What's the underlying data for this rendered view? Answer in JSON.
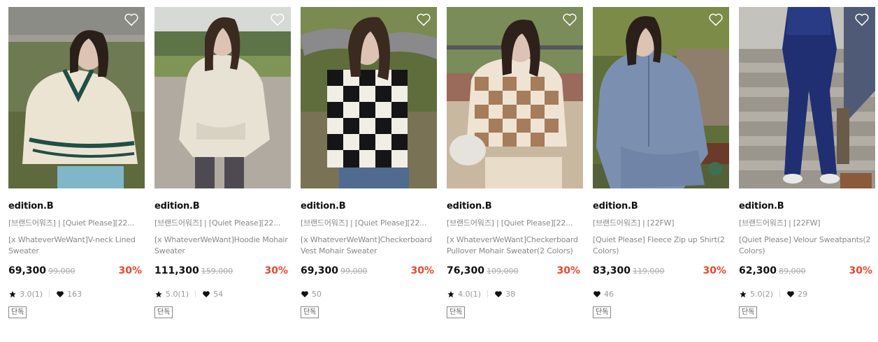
{
  "colors": {
    "discount": "#e8472b",
    "heart_outline": "#ffffff",
    "badge_border": "#888888"
  },
  "icons": {
    "wishlist": "heart-outline-icon",
    "rating": "star-icon",
    "likes": "heart-filled-icon"
  },
  "products": [
    {
      "brand": "edition.B",
      "name_line1": "[브랜드어워즈] | [Quiet Please][22...",
      "name_line2": "[x WhateverWeWant]V-neck Lined Sweater",
      "price": "69,300",
      "original_price": "99,000",
      "discount": "30%",
      "rating": "3.0(1)",
      "likes": "163",
      "badge": "단독"
    },
    {
      "brand": "edition.B",
      "name_line1": "[브랜드어워즈] | [Quiet Please][22...",
      "name_line2": "[x WhateverWeWant]Hoodie Mohair Sweater",
      "price": "111,300",
      "original_price": "159,000",
      "discount": "30%",
      "rating": "5.0(1)",
      "likes": "54",
      "badge": "단독"
    },
    {
      "brand": "edition.B",
      "name_line1": "[브랜드어워즈] | [Quiet Please][22...",
      "name_line2": "[x WhateverWeWant]Checkerboard Vest Mohair Sweater",
      "price": "69,300",
      "original_price": "99,000",
      "discount": "30%",
      "rating": null,
      "likes": "50",
      "badge": "단독"
    },
    {
      "brand": "edition.B",
      "name_line1": "[브랜드어워즈] | [Quiet Please][22...",
      "name_line2": "[x WhateverWeWant]Checkerboard Pullover Mohair Sweater(2 Colors)",
      "price": "76,300",
      "original_price": "109,000",
      "discount": "30%",
      "rating": "4.0(1)",
      "likes": "38",
      "badge": "단독"
    },
    {
      "brand": "edition.B",
      "name_line1": "[브랜드어워즈] | [22FW]",
      "name_line2": "[Quiet Please] Fleece Zip up Shirt(2 Colors)",
      "price": "83,300",
      "original_price": "119,000",
      "discount": "30%",
      "rating": null,
      "likes": "46",
      "badge": "단독"
    },
    {
      "brand": "edition.B",
      "name_line1": "[브랜드어워즈] | [22FW]",
      "name_line2": "[Quiet Please] Velour Sweatpants(2 Colors)",
      "price": "62,300",
      "original_price": "89,000",
      "discount": "30%",
      "rating": "5.0(2)",
      "likes": "29",
      "badge": "단독"
    }
  ]
}
